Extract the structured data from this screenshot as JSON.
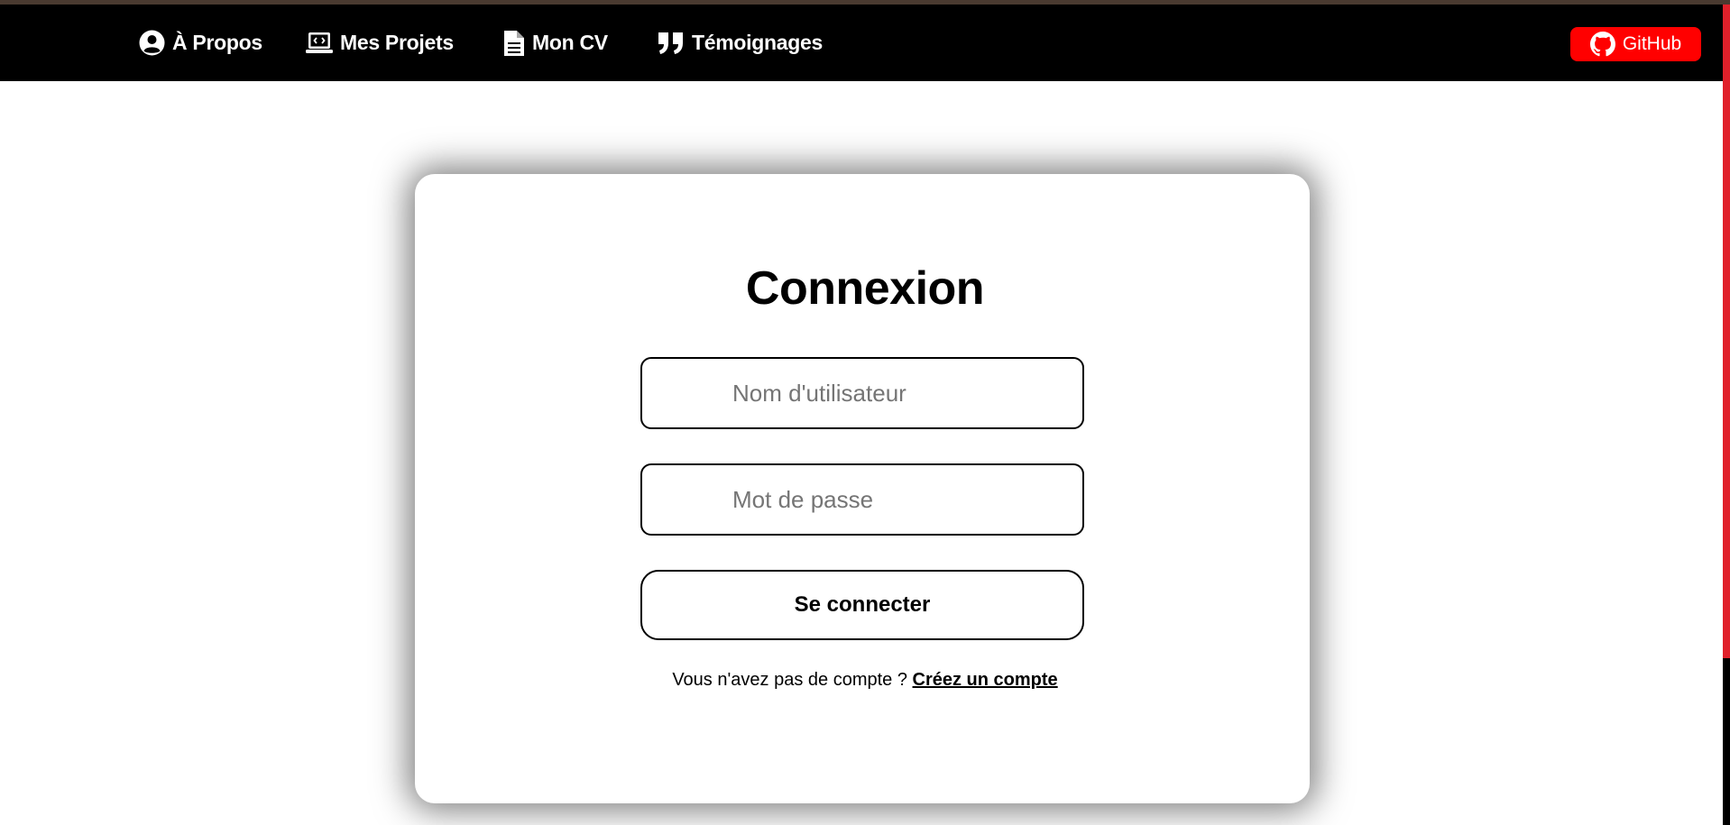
{
  "nav": {
    "items": [
      {
        "label": "À Propos",
        "icon": "user-circle-icon"
      },
      {
        "label": "Mes Projets",
        "icon": "laptop-code-icon"
      },
      {
        "label": "Mon CV",
        "icon": "document-icon"
      },
      {
        "label": "Témoignages",
        "icon": "quote-icon"
      }
    ],
    "github_label": "GitHub",
    "github_icon": "github-icon"
  },
  "login": {
    "title": "Connexion",
    "username_placeholder": "Nom d'utilisateur",
    "password_placeholder": "Mot de passe",
    "submit_label": "Se connecter",
    "signup_prompt": "Vous n'avez pas de compte ?",
    "signup_link": "Créez un compte"
  },
  "colors": {
    "navbar_bg": "#000000",
    "github_bg": "#ff0000",
    "page_bg": "#ffffff"
  }
}
